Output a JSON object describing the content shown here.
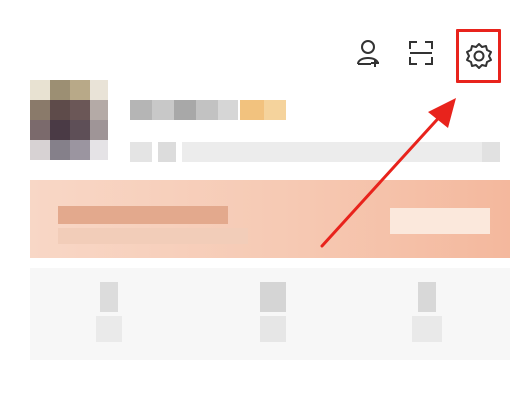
{
  "header": {
    "icons": {
      "add_user": "add-user-icon",
      "scan": "scan-icon",
      "settings": "gear-icon"
    }
  },
  "annotation": {
    "highlight_color": "#e8231c",
    "arrow_color": "#e8231c"
  },
  "colors": {
    "vip_card_start": "#f8d7c6",
    "vip_card_end": "#f4b89d",
    "stats_background": "#f7f7f7"
  }
}
